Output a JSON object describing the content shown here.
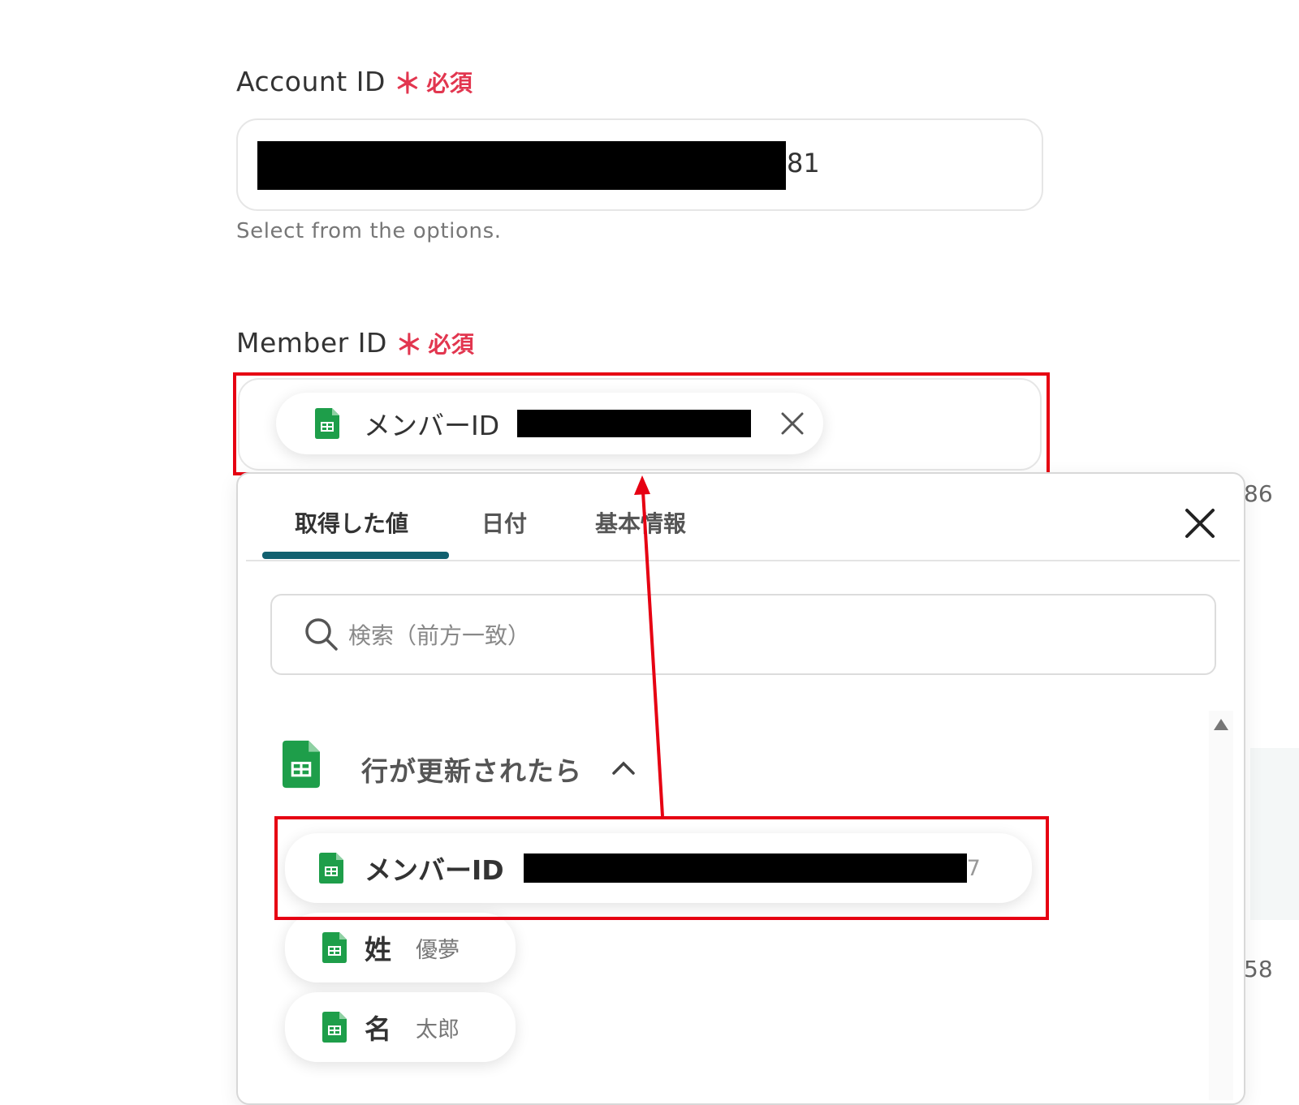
{
  "account_field": {
    "label": "Account ID",
    "required_star": "＊",
    "required_text": "必須",
    "value_suffix": "81",
    "help": "Select from the options."
  },
  "member_field": {
    "label": "Member ID",
    "required_star": "＊",
    "required_text": "必須",
    "chip_label": "メンバーID"
  },
  "picker": {
    "tabs": [
      {
        "label": "取得した値",
        "active": true
      },
      {
        "label": "日付",
        "active": false
      },
      {
        "label": "基本情報",
        "active": false
      }
    ],
    "search_placeholder": "検索（前方一致）",
    "group_title": "行が更新されたら",
    "rows": [
      {
        "label": "メンバーID",
        "value_suffix": "7"
      },
      {
        "label": "姓",
        "value": "優夢"
      },
      {
        "label": "名",
        "value": "太郎"
      }
    ]
  },
  "background_fragments": {
    "top": "86",
    "bottom": "58"
  },
  "colors": {
    "required": "#e2364f",
    "highlight": "#e60012",
    "tab_underline": "#11606f",
    "sheets_green": "#1e9e4a"
  }
}
